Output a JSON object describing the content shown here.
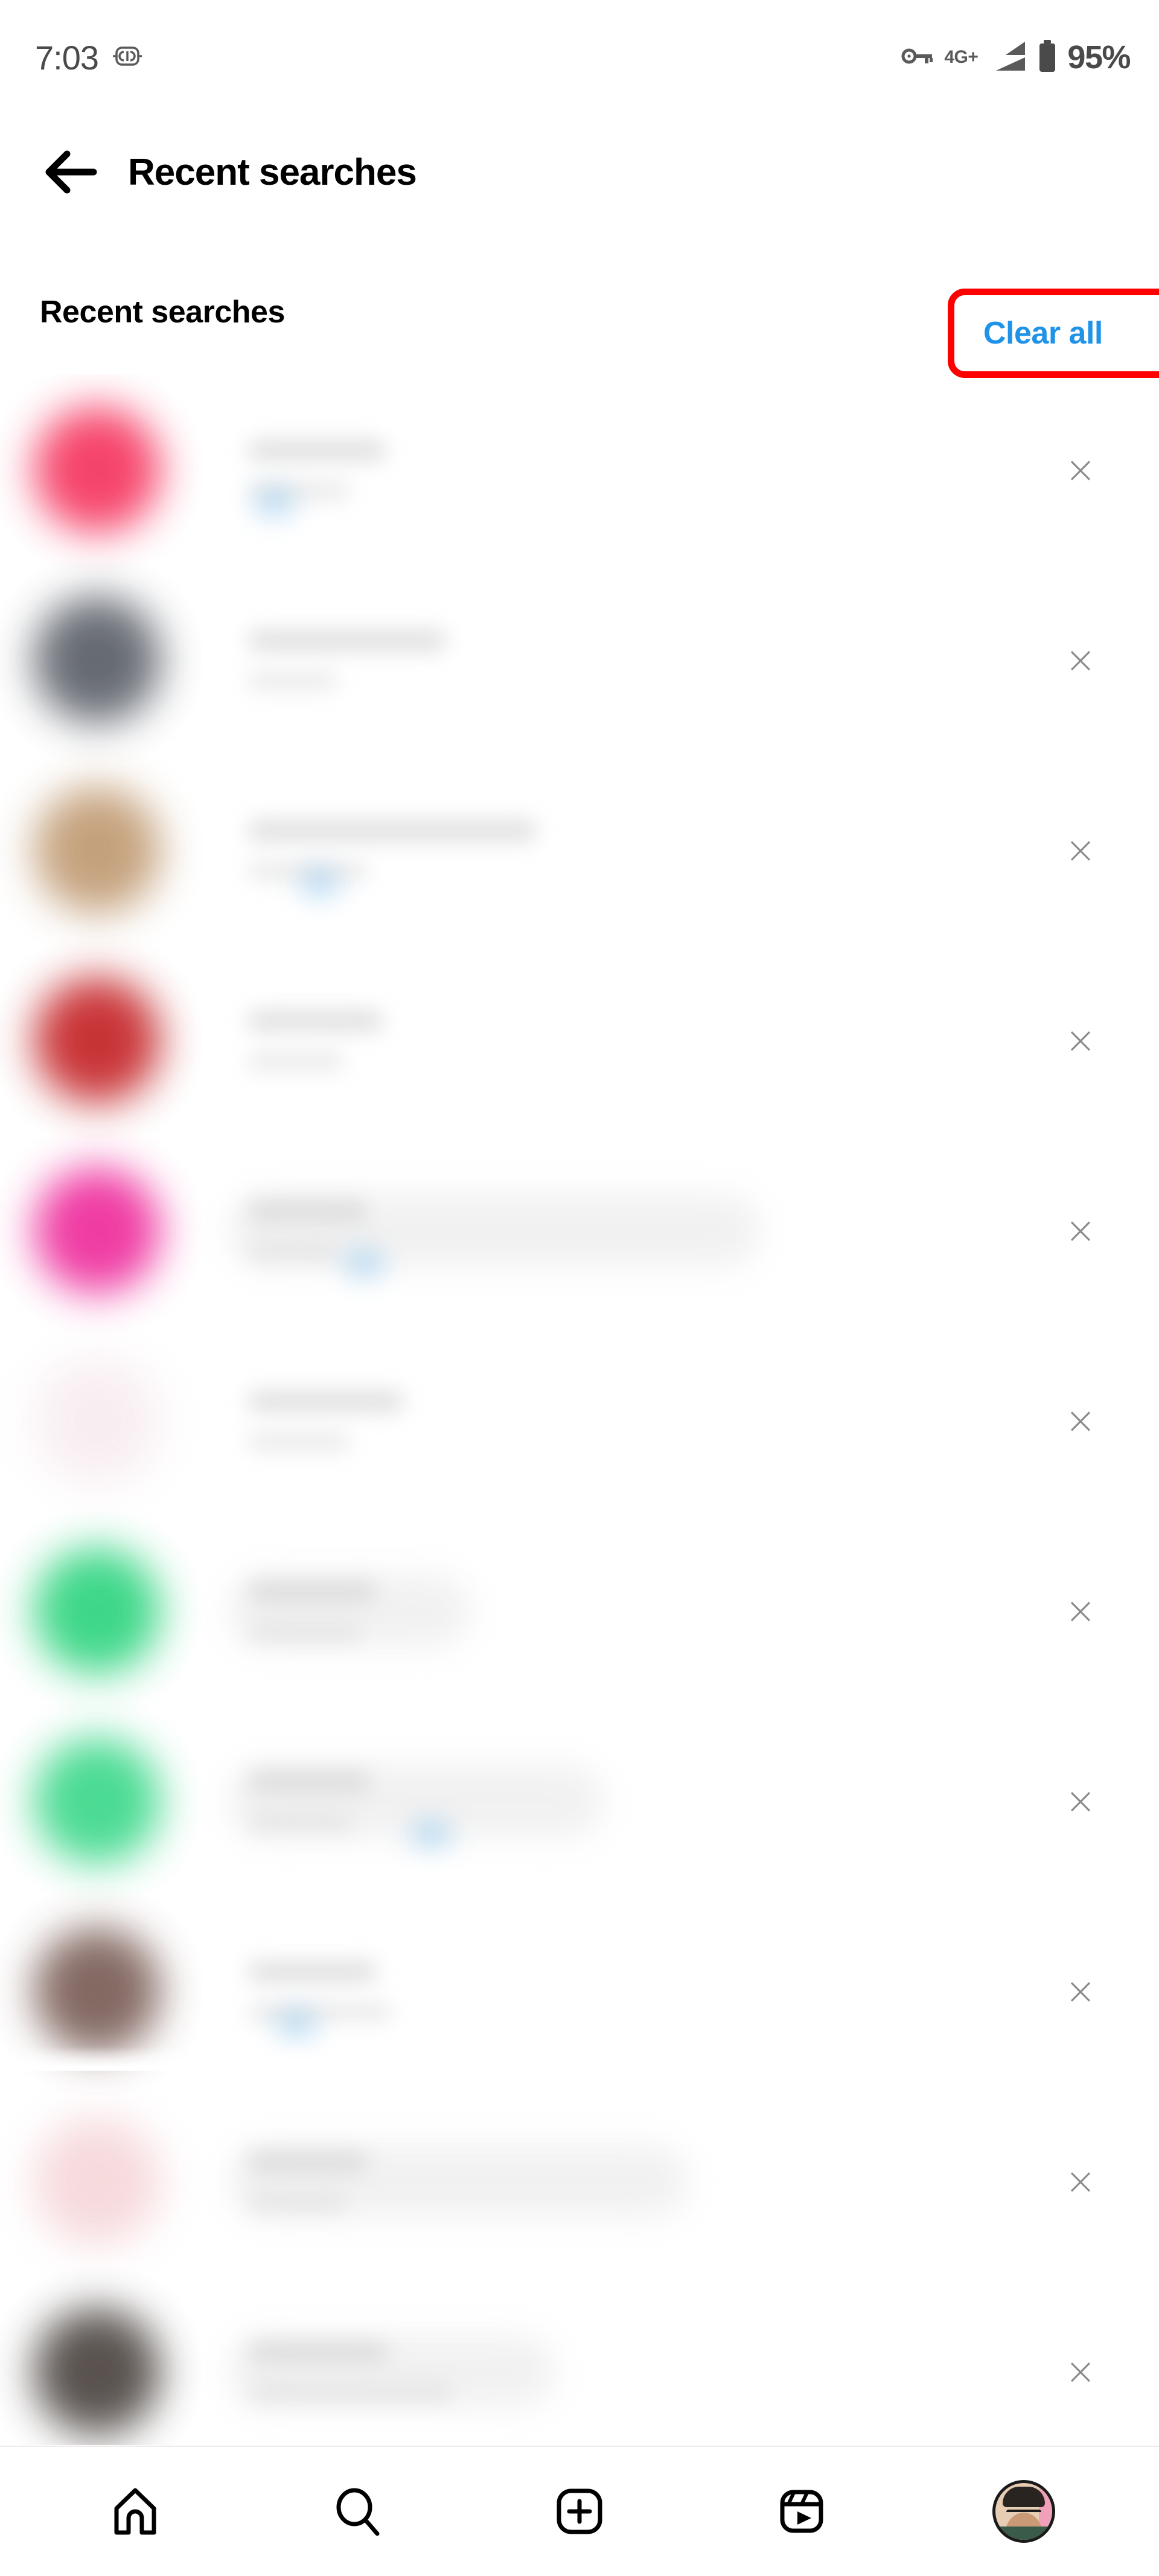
{
  "status_bar": {
    "time": "7:03",
    "alarm_icon": "alarm-clock-icon",
    "vpn_icon": "vpn-key-icon",
    "network_label": "4G+",
    "signal_icon": "signal-bars-icon",
    "battery_icon": "battery-icon",
    "battery_percent": "95%"
  },
  "header": {
    "back_icon": "back-arrow-icon",
    "title": "Recent searches"
  },
  "section": {
    "title": "Recent searches",
    "clear_all_label": "Clear all",
    "clear_all_color": "#1E93E8",
    "highlight_color": "#FF0000"
  },
  "list": {
    "close_glyph": "×",
    "rows": [
      {
        "avatar_color": "#F5355F",
        "line1_width": 230,
        "line2_width": 170,
        "blob_width": 0,
        "blue_dot": true
      },
      {
        "avatar_color": "#5A5F68",
        "line1_width": 330,
        "line2_width": 150,
        "blob_width": 0,
        "blue_dot": false
      },
      {
        "avatar_color": "#C09A72",
        "line1_width": 480,
        "line2_width": 200,
        "blob_width": 0,
        "blue_dot": true
      },
      {
        "avatar_color": "#C42326",
        "line1_width": 225,
        "line2_width": 160,
        "blob_width": 0,
        "blue_dot": false
      },
      {
        "avatar_color": "#EE2C9C",
        "line1_width": 200,
        "line2_width": 150,
        "blob_width": 880,
        "blue_dot": true
      },
      {
        "avatar_color": "#F8EDF1",
        "line1_width": 260,
        "line2_width": 170,
        "blob_width": 0,
        "blue_dot": false
      },
      {
        "avatar_color": "#2ED47E",
        "line1_width": 215,
        "line2_width": 190,
        "blob_width": 400,
        "blue_dot": false
      },
      {
        "avatar_color": "#3CD88A",
        "line1_width": 205,
        "line2_width": 175,
        "blob_width": 620,
        "blue_dot": true
      },
      {
        "avatar_color": "#7A5D56",
        "line1_width": 215,
        "line2_width": 240,
        "blob_width": 0,
        "blue_dot": true
      },
      {
        "avatar_color": "#F6D7DA",
        "line1_width": 200,
        "line2_width": 165,
        "blob_width": 760,
        "blue_dot": false
      },
      {
        "avatar_color": "#4B4440",
        "line1_width": 235,
        "line2_width": 340,
        "blob_width": 540,
        "blue_dot": false
      }
    ]
  },
  "bottom_nav": {
    "items": [
      {
        "name": "home-icon",
        "label": "Home"
      },
      {
        "name": "search-icon",
        "label": "Search"
      },
      {
        "name": "create-icon",
        "label": "Create"
      },
      {
        "name": "reels-icon",
        "label": "Reels"
      },
      {
        "name": "profile-avatar",
        "label": "Profile"
      }
    ]
  }
}
